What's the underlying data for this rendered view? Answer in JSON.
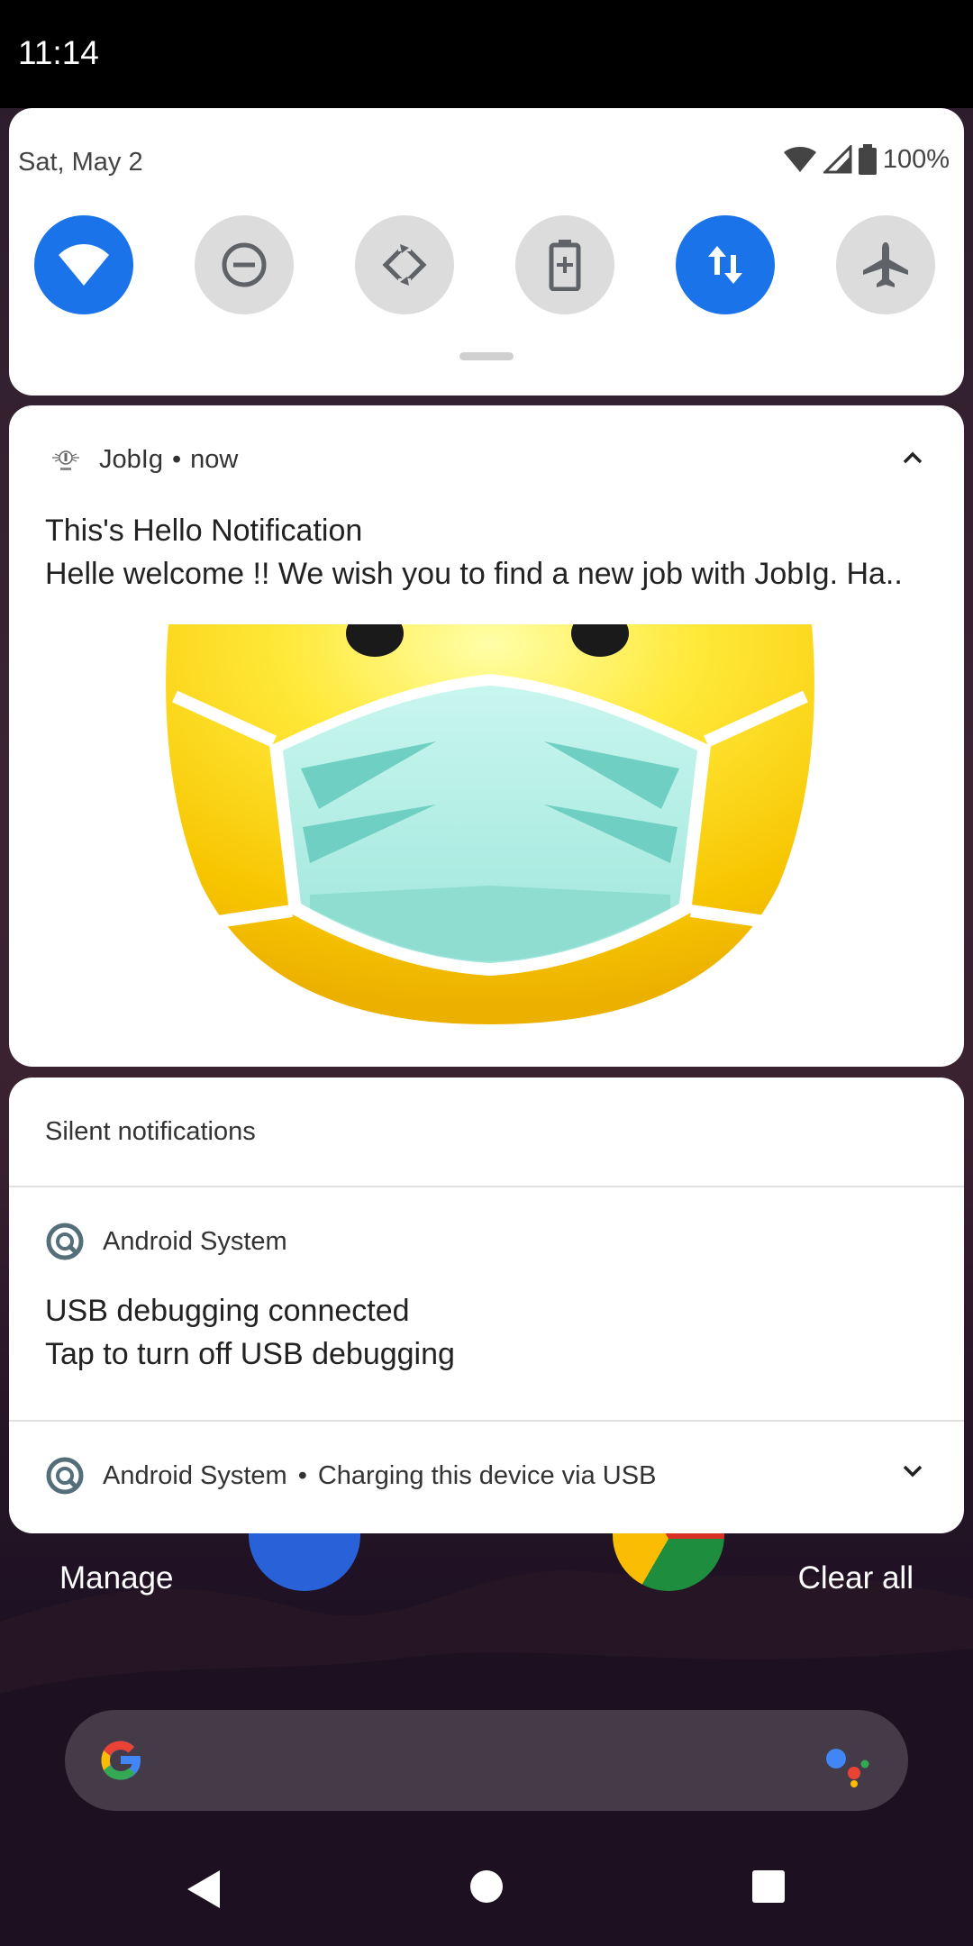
{
  "status_bar": {
    "time": "11:14"
  },
  "quick_settings": {
    "date": "Sat, May 2",
    "battery": "100%",
    "tiles": [
      {
        "name": "wifi",
        "on": true
      },
      {
        "name": "do-not-disturb",
        "on": false
      },
      {
        "name": "auto-rotate",
        "on": false
      },
      {
        "name": "battery-saver",
        "on": false
      },
      {
        "name": "mobile-data",
        "on": true
      },
      {
        "name": "airplane-mode",
        "on": false
      }
    ]
  },
  "notification": {
    "app_name": "JobIg",
    "separator": "•",
    "time": "now",
    "title": "This's Hello Notification",
    "text": "Helle welcome !! We wish you to find a new job with JobIg. Ha..",
    "picture": "masked-emoji"
  },
  "silent": {
    "header": "Silent notifications",
    "items": [
      {
        "app": "Android System",
        "title": "USB debugging connected",
        "text": "Tap to turn off USB debugging"
      },
      {
        "app": "Android System",
        "separator": "•",
        "summary": "Charging this device via USB"
      }
    ]
  },
  "footer": {
    "manage": "Manage",
    "clear_all": "Clear all"
  },
  "colors": {
    "accent": "#1a73e8",
    "tile_off": "#dcdcdc"
  }
}
